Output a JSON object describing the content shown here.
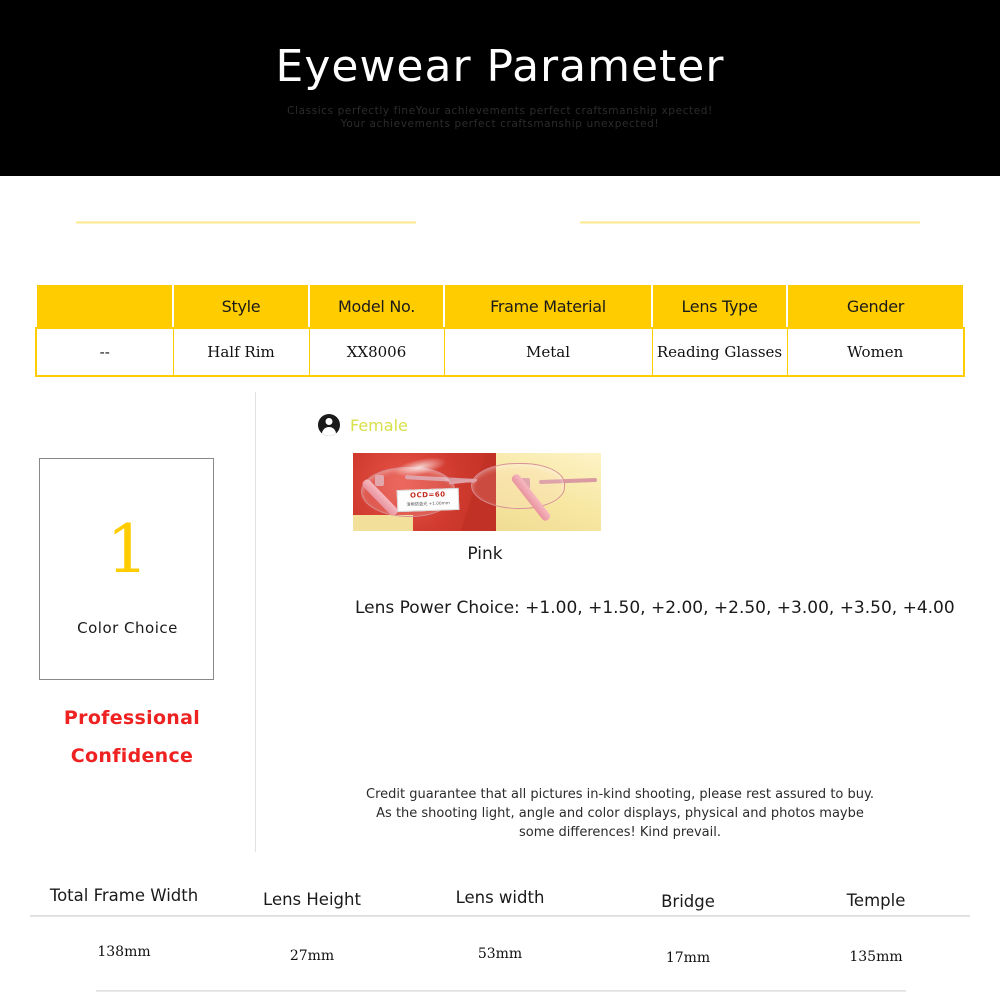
{
  "hero": {
    "title": "Eyewear Parameter",
    "subtitle_line1": "Classics perfectly fineYour  achievements perfect craftsmanship xpected!",
    "subtitle_line2": "Your achievements perfect craftsmanship unexpected!",
    "background_color": "#000000",
    "title_color": "#ffffff"
  },
  "accent_colors": {
    "yellow": "#FFCC00",
    "red": "#ef2222",
    "gender_green": "#d8e04a"
  },
  "spec_table": {
    "headers": [
      "",
      "Style",
      "Model No.",
      "Frame Material",
      "Lens Type",
      "Gender"
    ],
    "row": [
      "--",
      "Half Rim",
      "XX8006",
      "Metal",
      "Reading Glasses",
      "Women"
    ]
  },
  "color_choice": {
    "number": "1",
    "label": "Color Choice",
    "tagline_line1": "Professional",
    "tagline_line2": "Confidence"
  },
  "gender_badge": {
    "icon": "person-icon",
    "label": "Female"
  },
  "product": {
    "photo_alt": "pink half-rim reading glasses on red and yellow background",
    "lens_tag_main": "OCD=60",
    "lens_tag_sub": "清晰防蓝光 +1.00mm",
    "color_name": "Pink",
    "lens_power_label": "Lens Power Choice:",
    "lens_power_values": "+1.00, +1.50, +2.00, +2.50, +3.00, +3.50, +4.00",
    "lens_power_full": "Lens Power Choice: +1.00, +1.50, +2.00, +2.50, +3.00, +3.50, +4.00"
  },
  "disclaimer": {
    "line1": "Credit guarantee that all pictures in-kind shooting, please rest assured to buy.",
    "line2": "As the shooting light, angle and color displays, physical and photos maybe",
    "line3": "some differences! Kind prevail."
  },
  "measurements": {
    "labels": [
      "Total Frame Width",
      "Lens Height",
      "Lens width",
      "Bridge",
      "Temple"
    ],
    "values": [
      "138mm",
      "27mm",
      "53mm",
      "17mm",
      "135mm"
    ]
  }
}
